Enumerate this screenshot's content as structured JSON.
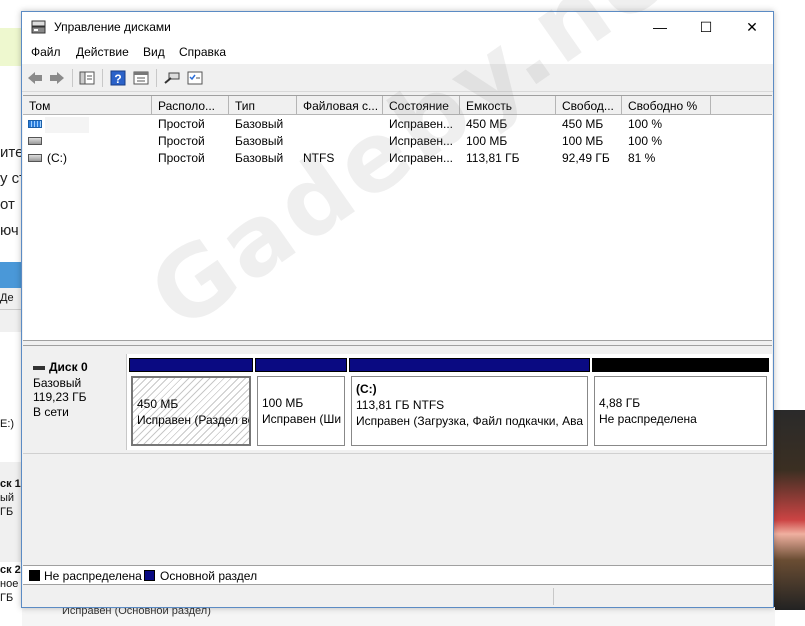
{
  "background_window": {
    "left_text_lines": [
      "ите",
      "у ст",
      "от",
      "юч"
    ],
    "left_small_lines": [
      "Де",
      "Е:)",
      "ск 1",
      "ый",
      "ГБ",
      "ск 2",
      "ное",
      "ГБ"
    ],
    "bottom_text": "Исправен (Основной раздел)"
  },
  "window": {
    "title": "Управление дисками",
    "icons": {
      "app": "disk-management-icon",
      "minimize": "minimize-icon",
      "maximize": "maximize-icon",
      "close": "close-icon"
    },
    "controls": {
      "minimize": "—",
      "maximize": "☐",
      "close": "✕"
    }
  },
  "menu": [
    "Файл",
    "Действие",
    "Вид",
    "Справка"
  ],
  "toolbar": {
    "icons": [
      "back-arrow-icon",
      "forward-arrow-icon",
      "console-tree-icon",
      "help-icon",
      "properties-icon",
      "rescan-icon",
      "checklist-icon"
    ]
  },
  "volume_table": {
    "columns": [
      "Том",
      "Располо...",
      "Тип",
      "Файловая с...",
      "Состояние",
      "Емкость",
      "Свобод...",
      "Свободно %"
    ],
    "rows": [
      {
        "icon": "volume-striped-icon",
        "name": "",
        "layout": "Простой",
        "type": "Базовый",
        "fs": "",
        "status": "Исправен...",
        "capacity": "450 МБ",
        "free": "450 МБ",
        "free_pct": "100 %"
      },
      {
        "icon": "volume-icon",
        "name": "",
        "layout": "Простой",
        "type": "Базовый",
        "fs": "",
        "status": "Исправен...",
        "capacity": "100 МБ",
        "free": "100 МБ",
        "free_pct": "100 %"
      },
      {
        "icon": "volume-icon",
        "name": "(C:)",
        "layout": "Простой",
        "type": "Базовый",
        "fs": "NTFS",
        "status": "Исправен...",
        "capacity": "113,81 ГБ",
        "free": "92,49 ГБ",
        "free_pct": "81 %"
      }
    ]
  },
  "disk": {
    "name": "Диск 0",
    "type": "Базовый",
    "size": "119,23 ГБ",
    "state": "В сети",
    "partitions": [
      {
        "label": "",
        "size": "450 МБ",
        "status": "Исправен (Раздел во",
        "kind": "primary",
        "hatched": true
      },
      {
        "label": "",
        "size": "100 МБ",
        "status": "Исправен (Ши",
        "kind": "primary",
        "hatched": false
      },
      {
        "label": "(C:)",
        "size": "113,81 ГБ NTFS",
        "status": "Исправен (Загрузка, Файл подкачки, Ава",
        "kind": "primary",
        "hatched": false
      },
      {
        "label": "",
        "size": "4,88 ГБ",
        "status": "Не распределена",
        "kind": "unallocated",
        "hatched": false
      }
    ]
  },
  "legend": [
    {
      "label": "Не распределена",
      "color": "#000000"
    },
    {
      "label": "Основной раздел",
      "color": "#0a0a82"
    }
  ],
  "watermark": "Gadeby.net"
}
